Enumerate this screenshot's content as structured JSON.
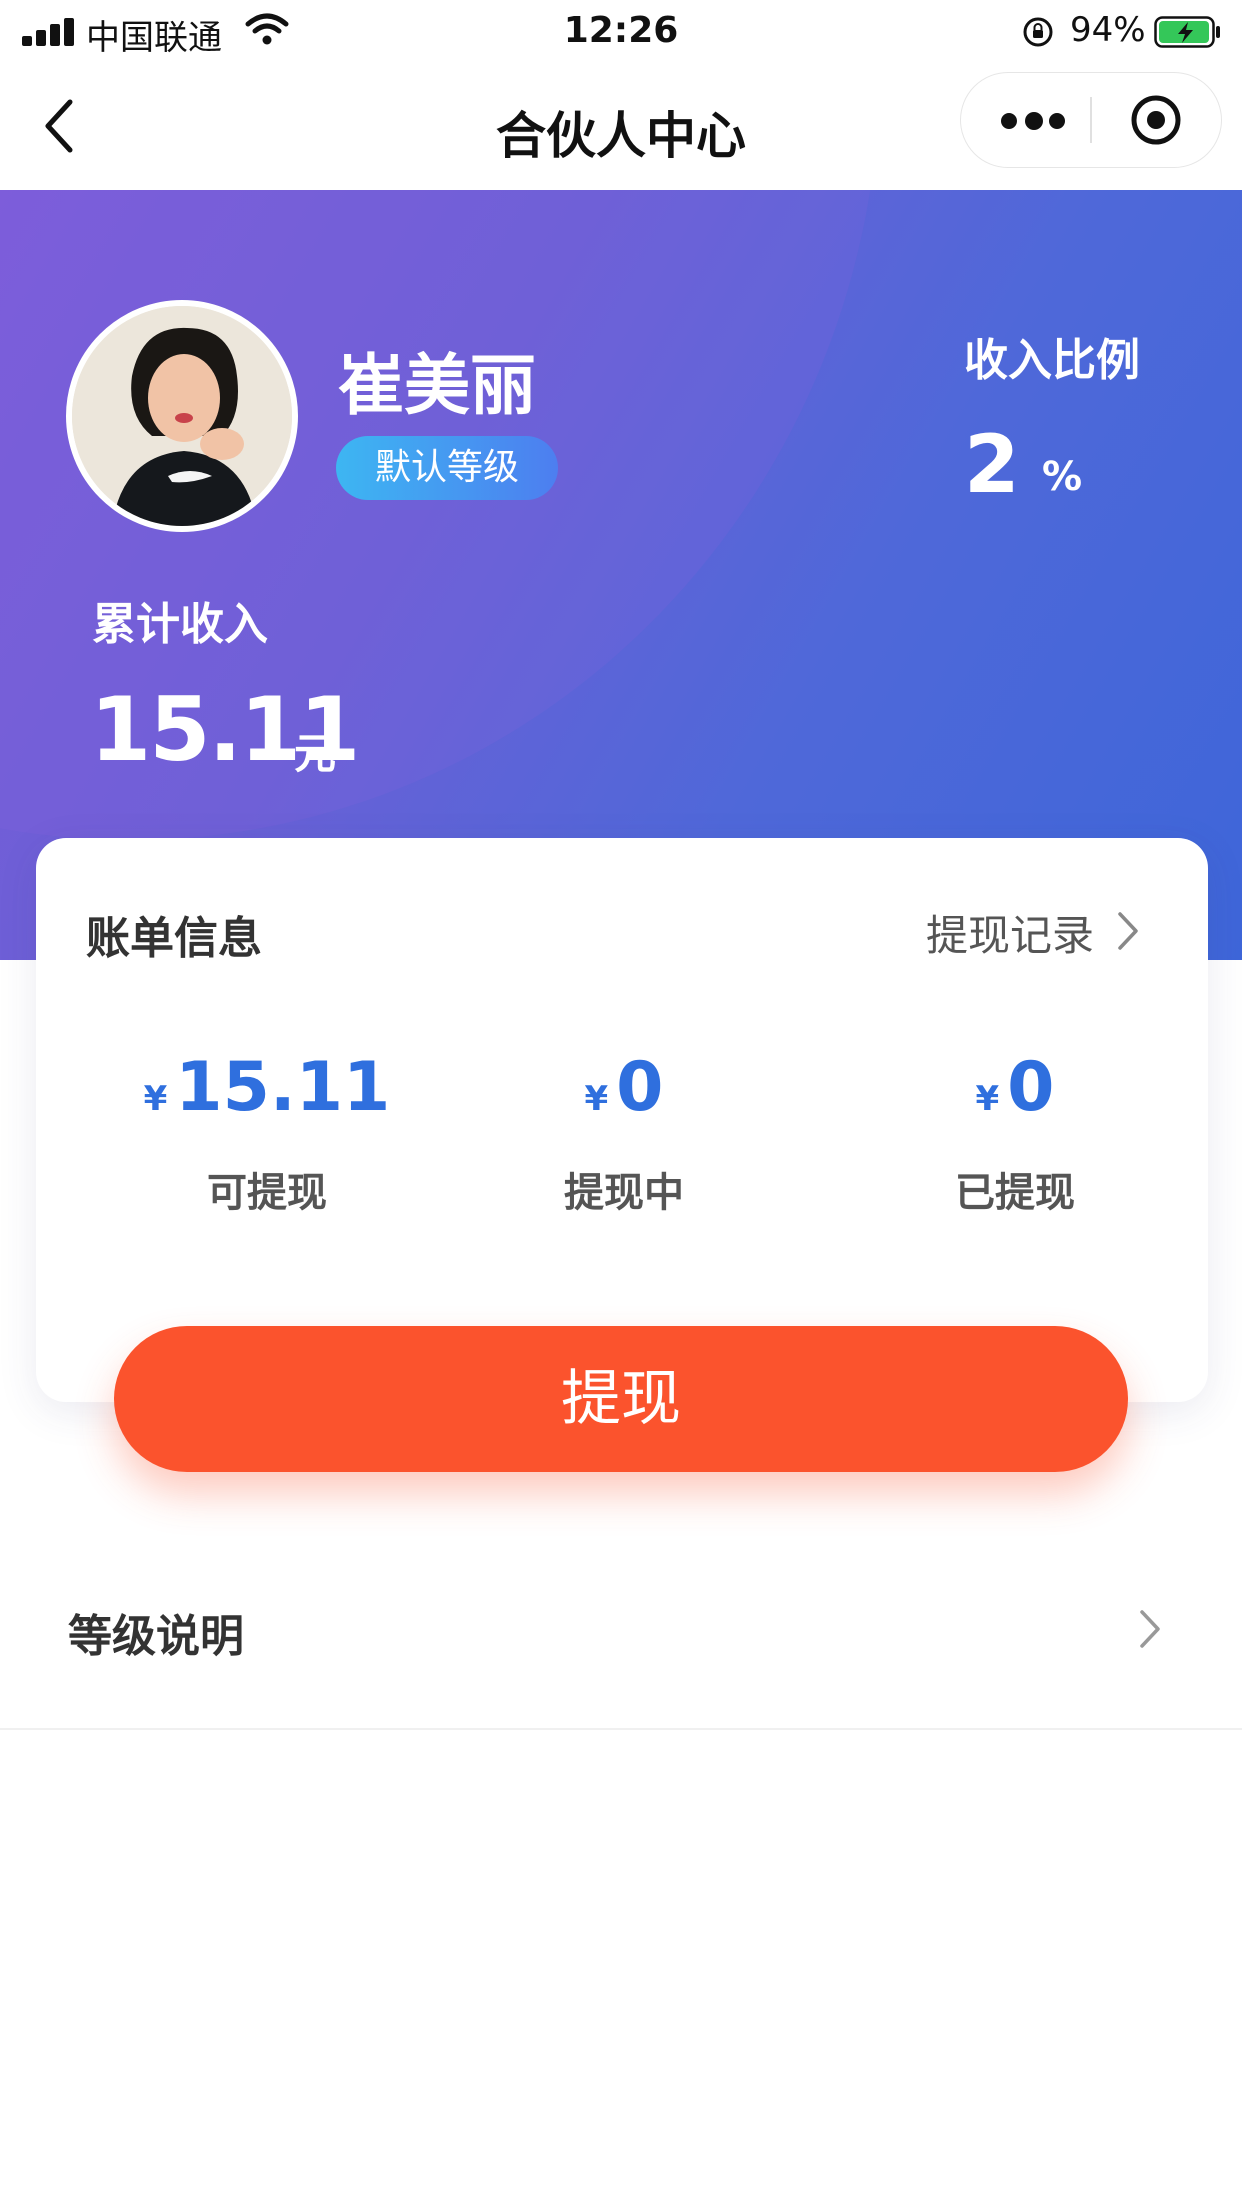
{
  "status_bar": {
    "carrier": "中国联通",
    "time": "12:26",
    "battery": "94%"
  },
  "nav": {
    "title": "合伙人中心",
    "icons": [
      "back-icon",
      "more-icon",
      "capsule-close-icon"
    ]
  },
  "profile": {
    "name": "崔美丽",
    "level": "默认等级",
    "ratio_label": "收入比例",
    "ratio_value": "2",
    "ratio_unit": "%",
    "total_label": "累计收入",
    "total_value": "15.11",
    "total_unit": "元"
  },
  "bill": {
    "title": "账单信息",
    "record_link": "提现记录",
    "currency": "¥",
    "stats": [
      {
        "value": "15.11",
        "label": "可提现"
      },
      {
        "value": "0",
        "label": "提现中"
      },
      {
        "value": "0",
        "label": "已提现"
      }
    ]
  },
  "withdraw_button": "提现",
  "level_info": {
    "label": "等级说明"
  },
  "colors": {
    "accent_blue": "#2f6fde",
    "button_orange": "#fb532d",
    "hero_start": "#7a5cd9",
    "hero_end": "#3e66d9"
  }
}
